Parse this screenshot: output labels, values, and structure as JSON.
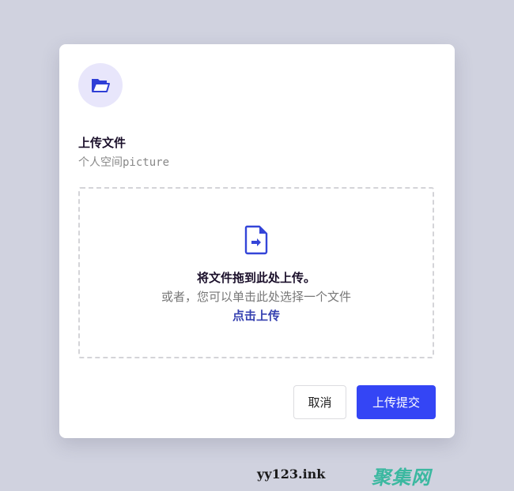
{
  "dialog": {
    "icon": "folder-open-icon",
    "title": "上传文件",
    "subtitle": "个人空间picture"
  },
  "dropzone": {
    "icon": "file-arrow-icon",
    "main_text": "将文件拖到此处上传。",
    "sub_text": "或者，您可以单击此处选择一个文件",
    "link_text": "点击上传"
  },
  "buttons": {
    "cancel_label": "取消",
    "submit_label": "上传提交"
  },
  "watermark": {
    "domain": "yy123.ink",
    "brand": "聚集网"
  },
  "colors": {
    "accent": "#3445f5",
    "icon_bg": "#e8e6fb",
    "link": "#3540b0",
    "background": "#d0d2df"
  }
}
